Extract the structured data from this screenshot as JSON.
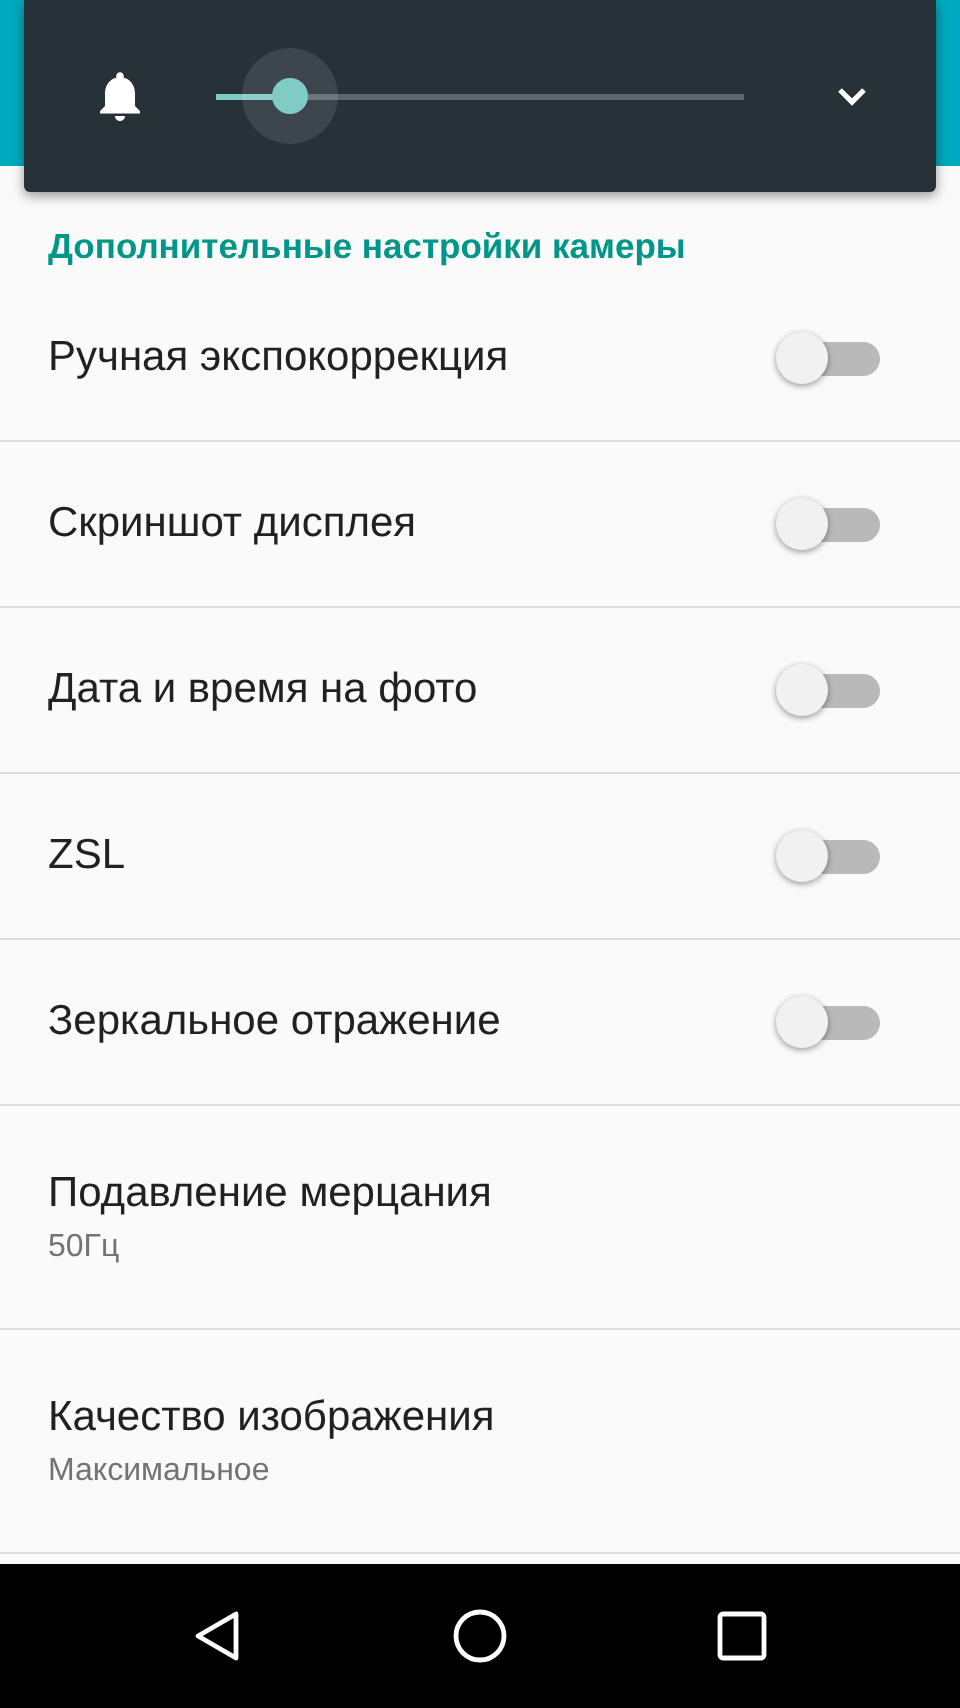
{
  "volume_panel": {
    "level": 0.14,
    "expanded": false
  },
  "section_title": "Дополнительные настройки камеры",
  "settings": [
    {
      "kind": "switch",
      "title": "Ручная экспокоррекция",
      "on": false
    },
    {
      "kind": "switch",
      "title": "Скриншот дисплея",
      "on": false
    },
    {
      "kind": "switch",
      "title": "Дата и время на фото",
      "on": false
    },
    {
      "kind": "switch",
      "title": "ZSL",
      "on": false
    },
    {
      "kind": "switch",
      "title": "Зеркальное отражение",
      "on": false
    },
    {
      "kind": "value",
      "title": "Подавление мерцания",
      "summary": "50Гц"
    },
    {
      "kind": "value",
      "title": "Качество изображения",
      "summary": "Максимальное"
    }
  ]
}
